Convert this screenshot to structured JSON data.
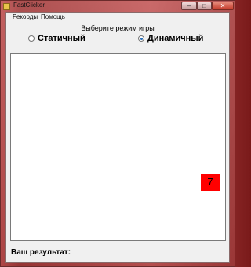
{
  "window": {
    "title": "FastClicker",
    "controls": {
      "minimize": "–",
      "maximize": "□",
      "close": "✕"
    }
  },
  "menu": {
    "items": [
      {
        "label": "Рекорды"
      },
      {
        "label": "Помощь"
      }
    ]
  },
  "mode": {
    "title": "Выберите режим игры",
    "options": [
      {
        "label": "Статичный",
        "checked": false
      },
      {
        "label": "Динамичный",
        "checked": true
      }
    ]
  },
  "game": {
    "target_label": "7",
    "target_color": "#ff0000"
  },
  "result": {
    "label": "Ваш результат:",
    "value": ""
  },
  "colors": {
    "accent": "#2a6fb8",
    "window_background": "#f0f0f0"
  },
  "icons": [
    "app-icon",
    "minimize-icon",
    "maximize-icon",
    "close-icon"
  ]
}
